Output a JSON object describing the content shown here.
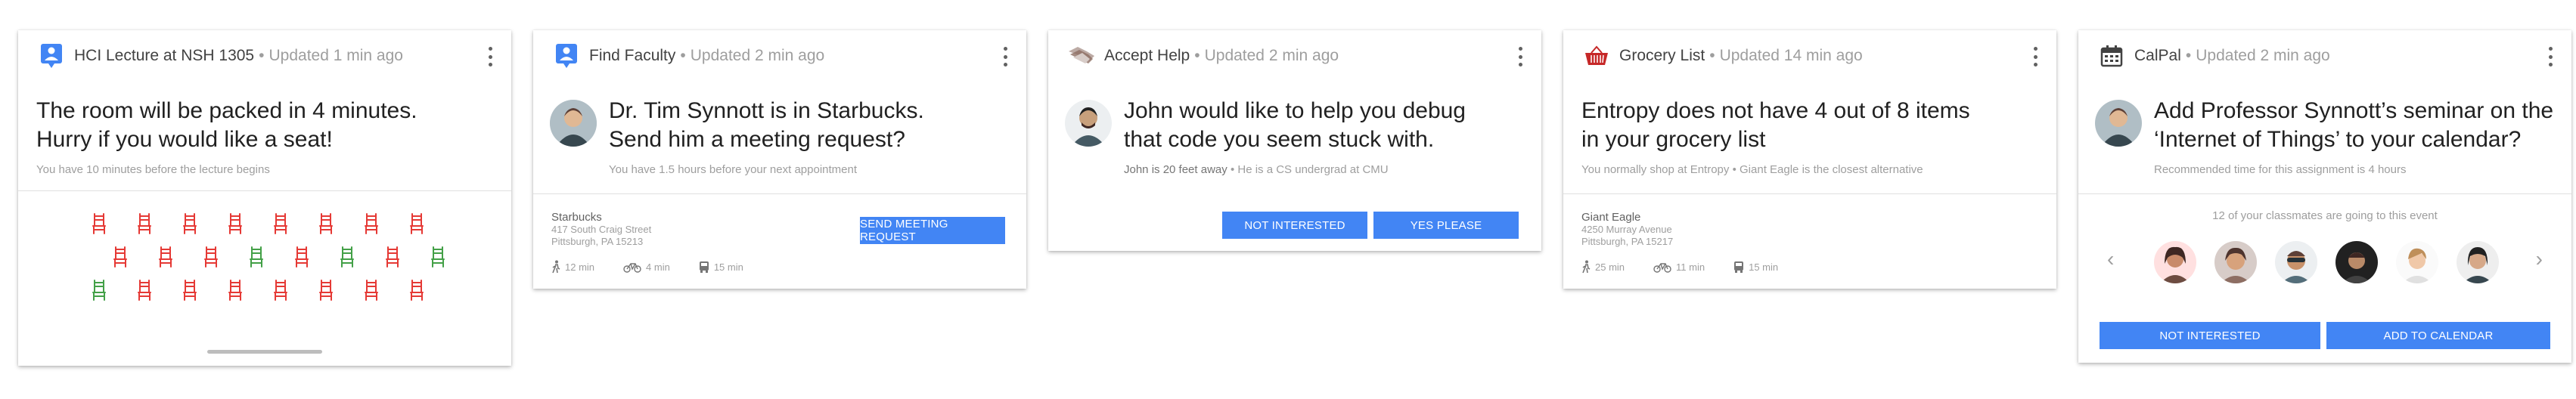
{
  "cards": [
    {
      "title": "HCI Lecture at NSH 1305",
      "updated": "Updated 1 min ago",
      "headline_1": "The room will be packed in 4 minutes.",
      "headline_2": "Hurry if you would like a seat!",
      "subtext": "You have 10 minutes before the lecture begins",
      "seat_rows": [
        [
          "red",
          "red",
          "red",
          "red",
          "red",
          "red",
          "red",
          "red"
        ],
        [
          "red",
          "red",
          "red",
          "green",
          "red",
          "green",
          "red",
          "green"
        ],
        [
          "green",
          "red",
          "red",
          "red",
          "red",
          "red",
          "red",
          "red"
        ]
      ],
      "colors": {
        "taken": "#e53935",
        "free": "#43a047",
        "icon": "#4285f4"
      }
    },
    {
      "title": "Find Faculty",
      "updated": "Updated 2 min ago",
      "headline_1": "Dr. Tim Synnott is in Starbucks.",
      "headline_2": "Send him a meeting request?",
      "subtext": "You have 1.5 hours before your next appointment",
      "location_name": "Starbucks",
      "address_1": "417 South Craig Street",
      "address_2": "Pittsburgh, PA 15213",
      "walk": "12 min",
      "bike": "4 min",
      "bus": "15 min",
      "button": "SEND MEETING REQUEST"
    },
    {
      "title": "Accept Help",
      "updated": "Updated 2 min ago",
      "headline_1": "John would like to help you debug",
      "headline_2": "that code you seem stuck with.",
      "subtext_a": "John is 20 feet away",
      "subtext_b": "He is a CS undergrad at CMU",
      "button_no": "NOT INTERESTED",
      "button_yes": "YES PLEASE"
    },
    {
      "title": "Grocery List",
      "updated": "Updated 14 min ago",
      "headline_1": "Entropy does not have 4 out of 8 items",
      "headline_2": "in your grocery list",
      "subtext_a": "You normally shop at Entropy",
      "subtext_b": "Giant Eagle is the closest alternative",
      "location_name": "Giant Eagle",
      "address_1": "4250 Murray Avenue",
      "address_2": "Pittsburgh, PA 15217",
      "walk": "25 min",
      "bike": "11 min",
      "bus": "15 min"
    },
    {
      "title": "CalPal",
      "updated": "Updated 2 min ago",
      "headline_1": "Add Professor Synnott’s seminar on the",
      "headline_2": "‘Internet of Things’ to your calendar?",
      "subtext": "Recommended time for this assignment is 4 hours",
      "classmates_text": "12 of your classmates are going to this event",
      "button_no": "NOT INTERESTED",
      "button_yes": "ADD TO CALENDAR"
    }
  ],
  "separator": "•",
  "icons": {
    "lecture": "person-pin-icon",
    "faculty": "person-pin-icon",
    "help": "handshake-icon",
    "grocery": "basket-icon",
    "calendar": "calendar-icon",
    "walk": "walk-icon",
    "bike": "bike-icon",
    "bus": "bus-icon"
  }
}
